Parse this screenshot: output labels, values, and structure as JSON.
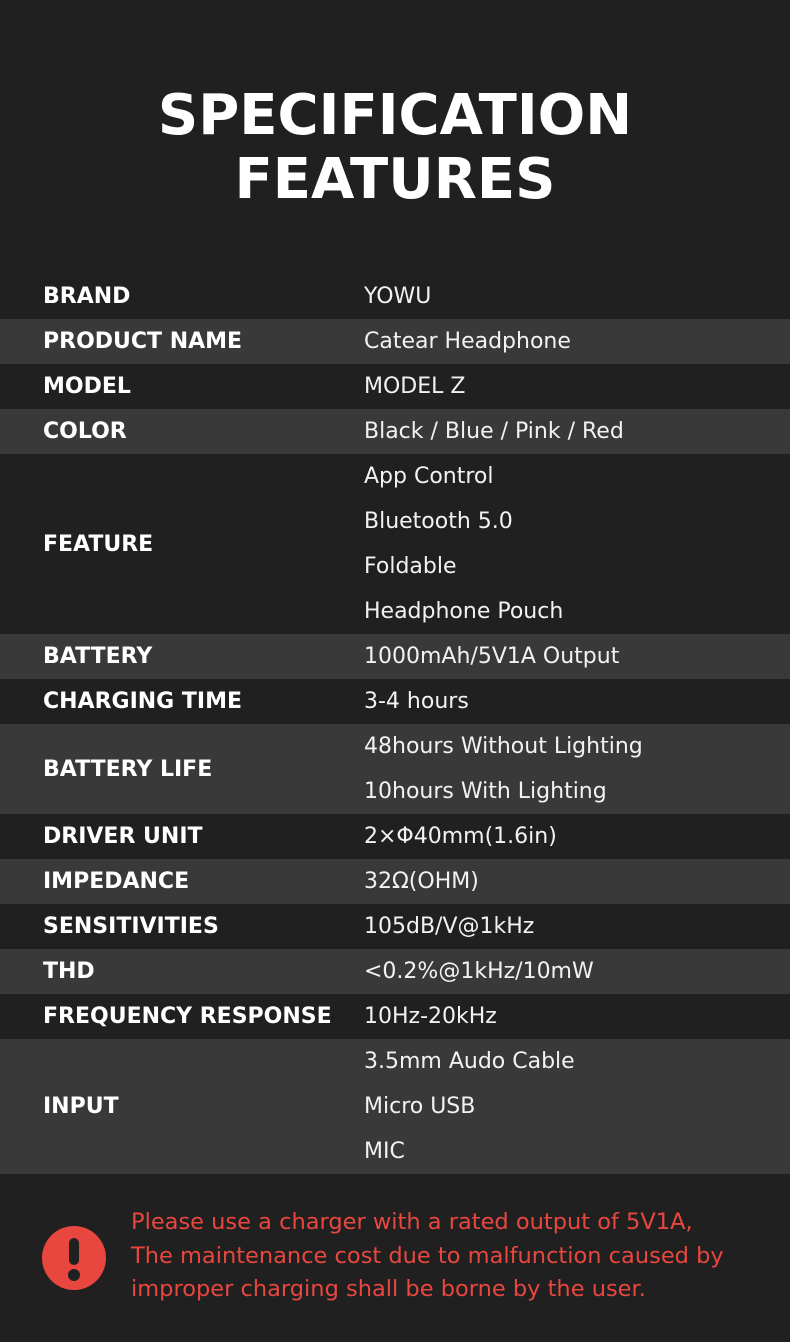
{
  "title": {
    "line1": "SPECIFICATION",
    "line2": "FEATURES"
  },
  "specs": [
    {
      "label": "BRAND",
      "values": [
        "YOWU"
      ]
    },
    {
      "label": "PRODUCT NAME",
      "values": [
        "Catear Headphone"
      ]
    },
    {
      "label": "MODEL",
      "values": [
        "MODEL Z"
      ]
    },
    {
      "label": "COLOR",
      "values": [
        "Black / Blue / Pink / Red"
      ]
    },
    {
      "label": "FEATURE",
      "values": [
        "App Control",
        "Bluetooth 5.0",
        "Foldable",
        "Headphone Pouch"
      ]
    },
    {
      "label": "BATTERY",
      "values": [
        "1000mAh/5V1A Output"
      ]
    },
    {
      "label": "CHARGING TIME",
      "values": [
        "3-4 hours"
      ]
    },
    {
      "label": "BATTERY LIFE",
      "values": [
        "48hours Without Lighting",
        "10hours With Lighting"
      ]
    },
    {
      "label": "DRIVER UNIT",
      "values": [
        "2×Φ40mm(1.6in)"
      ]
    },
    {
      "label": "IMPEDANCE",
      "values": [
        "32Ω(OHM)"
      ]
    },
    {
      "label": "SENSITIVITIES",
      "values": [
        "105dB/V@1kHz"
      ]
    },
    {
      "label": "THD",
      "values": [
        "<0.2%@1kHz/10mW"
      ]
    },
    {
      "label": "FREQUENCY RESPONSE",
      "values": [
        "10Hz-20kHz"
      ]
    },
    {
      "label": "INPUT",
      "values": [
        "3.5mm Audo Cable",
        "Micro USB",
        "MIC"
      ]
    }
  ],
  "notice": {
    "icon": "exclamation-icon",
    "lines": [
      "Please use a charger with a rated output of 5V1A,",
      "The maintenance cost due to malfunction caused by",
      "improper charging shall be borne by the user."
    ]
  },
  "colors": {
    "background": "#202020",
    "row_alt": "#393939",
    "warning": "#e8473f"
  }
}
